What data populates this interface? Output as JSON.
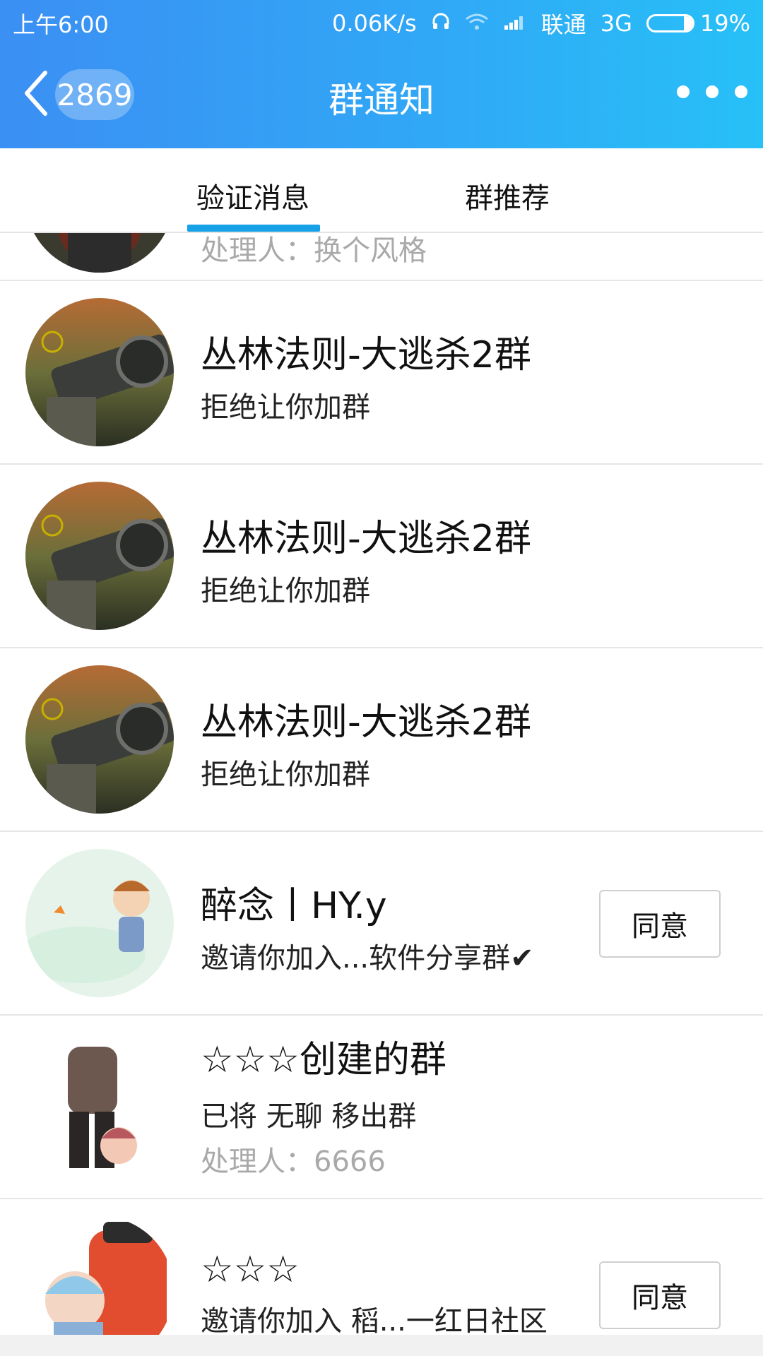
{
  "status_bar": {
    "time": "上午6:00",
    "speed": "0.06K/s",
    "carrier": "联通",
    "network": "3G",
    "battery": "19%",
    "battery_level": 0.19
  },
  "header": {
    "back_count": "2869",
    "title": "群通知"
  },
  "tabs": [
    {
      "label": "验证消息",
      "active": true
    },
    {
      "label": "群推荐",
      "active": false
    }
  ],
  "items": [
    {
      "handler": "处理人：换个风格"
    },
    {
      "title": "丛林法则-大逃杀2群",
      "subtitle": "拒绝让你加群"
    },
    {
      "title": "丛林法则-大逃杀2群",
      "subtitle": "拒绝让你加群"
    },
    {
      "title": "丛林法则-大逃杀2群",
      "subtitle": "拒绝让你加群"
    },
    {
      "title": "醉念丨HY.y",
      "subtitle": "邀请你加入...软件分享群✔",
      "button": "同意"
    },
    {
      "title": "☆☆☆创建的群",
      "subtitle": "已将 无聊 移出群",
      "handler": "处理人：6666"
    },
    {
      "title": "☆☆☆",
      "subtitle": "邀请你加入 稻...一红日社区",
      "button": "同意"
    }
  ]
}
